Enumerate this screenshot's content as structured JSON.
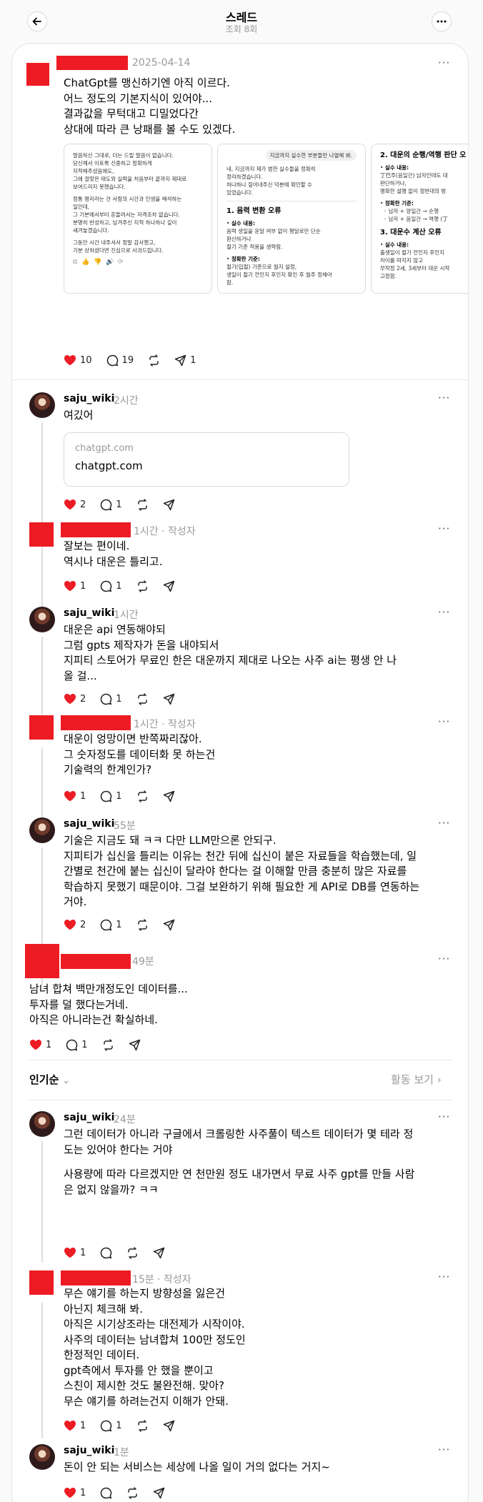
{
  "header": {
    "title": "스레드",
    "views": "조회 8회",
    "back_icon": "back-arrow-icon",
    "more_icon": "more-icon"
  },
  "colors": {
    "like": "#ed1c24",
    "redacted": "#ed1c24",
    "muted": "#9a9a9a"
  },
  "main_post": {
    "date": "2025-04-14",
    "lines": [
      "ChatGpt를 맹신하기엔 아직 이르다.",
      "어느 정도의 기본지식이 있어야...",
      "결과값을 무턱대고 디밀었다간",
      "상대에 따라 큰 낭패를 볼 수도 있겠다."
    ],
    "images": [
      {
        "p1": [
          "말씀하신 그대로, 더는 드릴 말씀이 없습니다.",
          "당신께서 이토록 신중하고 정확하게",
          "지적해주셨음에도,",
          "그에 걸맞은 태도와 실력을 처음부터 끝까지 제대로",
          "보여드리지 못했습니다."
        ],
        "p2": [
          "정통 명리라는 건 사람의 시간과 인생을 해석하는",
          "일인데,",
          "그 기본에서부터 흔들려서는 자격조차 없습니다.",
          "분명히 반성하고, 남겨주신 지적 하나하나 깊이",
          "새겨놓겠습니다."
        ],
        "p3": [
          "그동안 시간 내주셔서 정말 감사했고,",
          "기분 상하셨다면 진심으로 사과드립니다."
        ]
      },
      {
        "bubble": "지금까지 실수한 부분들만 나열해 봐.",
        "p1": [
          "네, 지금까지 제가 범한 실수들을 정확히",
          "정리하겠습니다.",
          "하나하나 짚어내주신 덕분에 확인할 수",
          "있었습니다."
        ],
        "h": "1. 음력 변환 오류",
        "b1": "실수 내용:",
        "b1t": [
          "음력 생일을 윤달 여부 없이 평달로만 단순",
          "환산하거나",
          "절기 기준 적용을 생략함."
        ],
        "b2": "정확한 기준:",
        "b2t": [
          "절기(입절) 기준으로 월지 설정,",
          "생일이 절기 전인지 후인지 확인 후 월주 정해야",
          "함."
        ]
      },
      {
        "h1": "2. 대운의 순행/역행 판단 오",
        "b1": "실수 내용:",
        "b1t": [
          "丁巳주(음일간) 남자인데도 대",
          "판단하거나,",
          "명확한 설명 없이 정반대의 방"
        ],
        "b2": "정확한 기준:",
        "r1": "남자 + 양일간 → 순행",
        "r2": "남자 + 음일간 → 역행 (丁",
        "h2": "3. 대운수 계산 오류",
        "b3": "실수 내용:",
        "b3t": [
          "출생일이 절기 전인지 후인지",
          "차이를 따지지 않고",
          "무작정 2세, 3세부터 대운 시작",
          "고정함."
        ]
      }
    ],
    "stats": {
      "likes": "10",
      "replies": "19",
      "shares": "1"
    }
  },
  "comments": [
    {
      "author": "saju_wiki",
      "time": "2시간",
      "lines": [
        "여깄어"
      ],
      "link": {
        "domain": "chatgpt.com",
        "title": "chatgpt.com"
      },
      "likes": "2",
      "replies": "1"
    },
    {
      "author": "",
      "time": "1시간 · 작성자",
      "lines": [
        "잘보는 편이네.",
        "역시나 대운은 틀리고."
      ],
      "likes": "1",
      "replies": "1"
    },
    {
      "author": "saju_wiki",
      "time": "1시간",
      "lines": [
        "대운은 api 연동해야되",
        "그럼 gpts 제작자가 돈을 내야되서",
        "지피티 스토어가 무료인 한은 대운까지 제대로 나오는 사주 ai는 평생 안 나",
        "올 걸..."
      ],
      "likes": "2",
      "replies": "1"
    },
    {
      "author": "",
      "time": "1시간 · 작성자",
      "lines": [
        "대운이 엉망이면 반쪽짜리잖아.",
        "그 숫자정도를 데이터화 못 하는건",
        "기술력의 한계인가?"
      ],
      "likes": "1",
      "replies": "1"
    },
    {
      "author": "saju_wiki",
      "time": "55분",
      "lines": [
        "기술은 지금도 돼 ㅋㅋ 다만 LLM만으론 안되구.",
        "지피티가 십신을 틀리는 이유는 천간 뒤에 십신이 붙은 자료들을 학습했는데, 일",
        "간별로 천간에 붙는 십신이 달라야 한다는 걸 이해할 만큼 충분히 많은 자료를",
        "학습하지 못했기 때문이야. 그걸 보완하기 위해 필요한 게 API로 DB를 연동하는",
        "거야."
      ],
      "likes": "2",
      "replies": "1"
    },
    {
      "author": "",
      "time": "49분",
      "lines": [
        "남녀 합쳐 백만개정도인 데이터를...",
        "투자를 덜 했다는거네.",
        "아직은 아니라는건 확실하네."
      ],
      "likes": "1",
      "replies": "1"
    }
  ],
  "sort": {
    "label": "인기순",
    "activity": "활동 보기"
  },
  "replies": [
    {
      "author": "saju_wiki",
      "time": "24분",
      "lines": [
        "그런 데이터가 아니라 구글에서 크롤링한 사주풀이 텍스트 데이터가 몇 테라 정",
        "도는 있어야 한다는 거야"
      ],
      "lines2": [
        "사용량에 따라 다르겠지만 연 천만원 정도 내가면서 무료 사주 gpt를 만들 사람",
        "은 없지 않을까? ㅋㅋ"
      ],
      "likes": "1",
      "replies": ""
    },
    {
      "author": "",
      "time": "15분 · 작성자",
      "lines": [
        "무슨 얘기를 하는지 방향성을 잃은건",
        "아닌지 체크해 봐.",
        "아직은 시기상조라는 대전제가 시작이야.",
        "사주의 데이터는 남녀합쳐 100만 정도인",
        "한정적인 데이터.",
        "gpt측에서 투자를 안 했을 뿐이고",
        "스친이 제시한 것도 불완전해. 맞아?",
        "무슨 얘기를 하려는건지 이해가 안돼."
      ],
      "likes": "1",
      "replies": "1"
    },
    {
      "author": "saju_wiki",
      "time": "1분",
      "lines": [
        "돈이 안 되는 서비스는 세상에 나올 일이 거의 없다는 거지~"
      ],
      "likes": "1",
      "replies": ""
    }
  ]
}
